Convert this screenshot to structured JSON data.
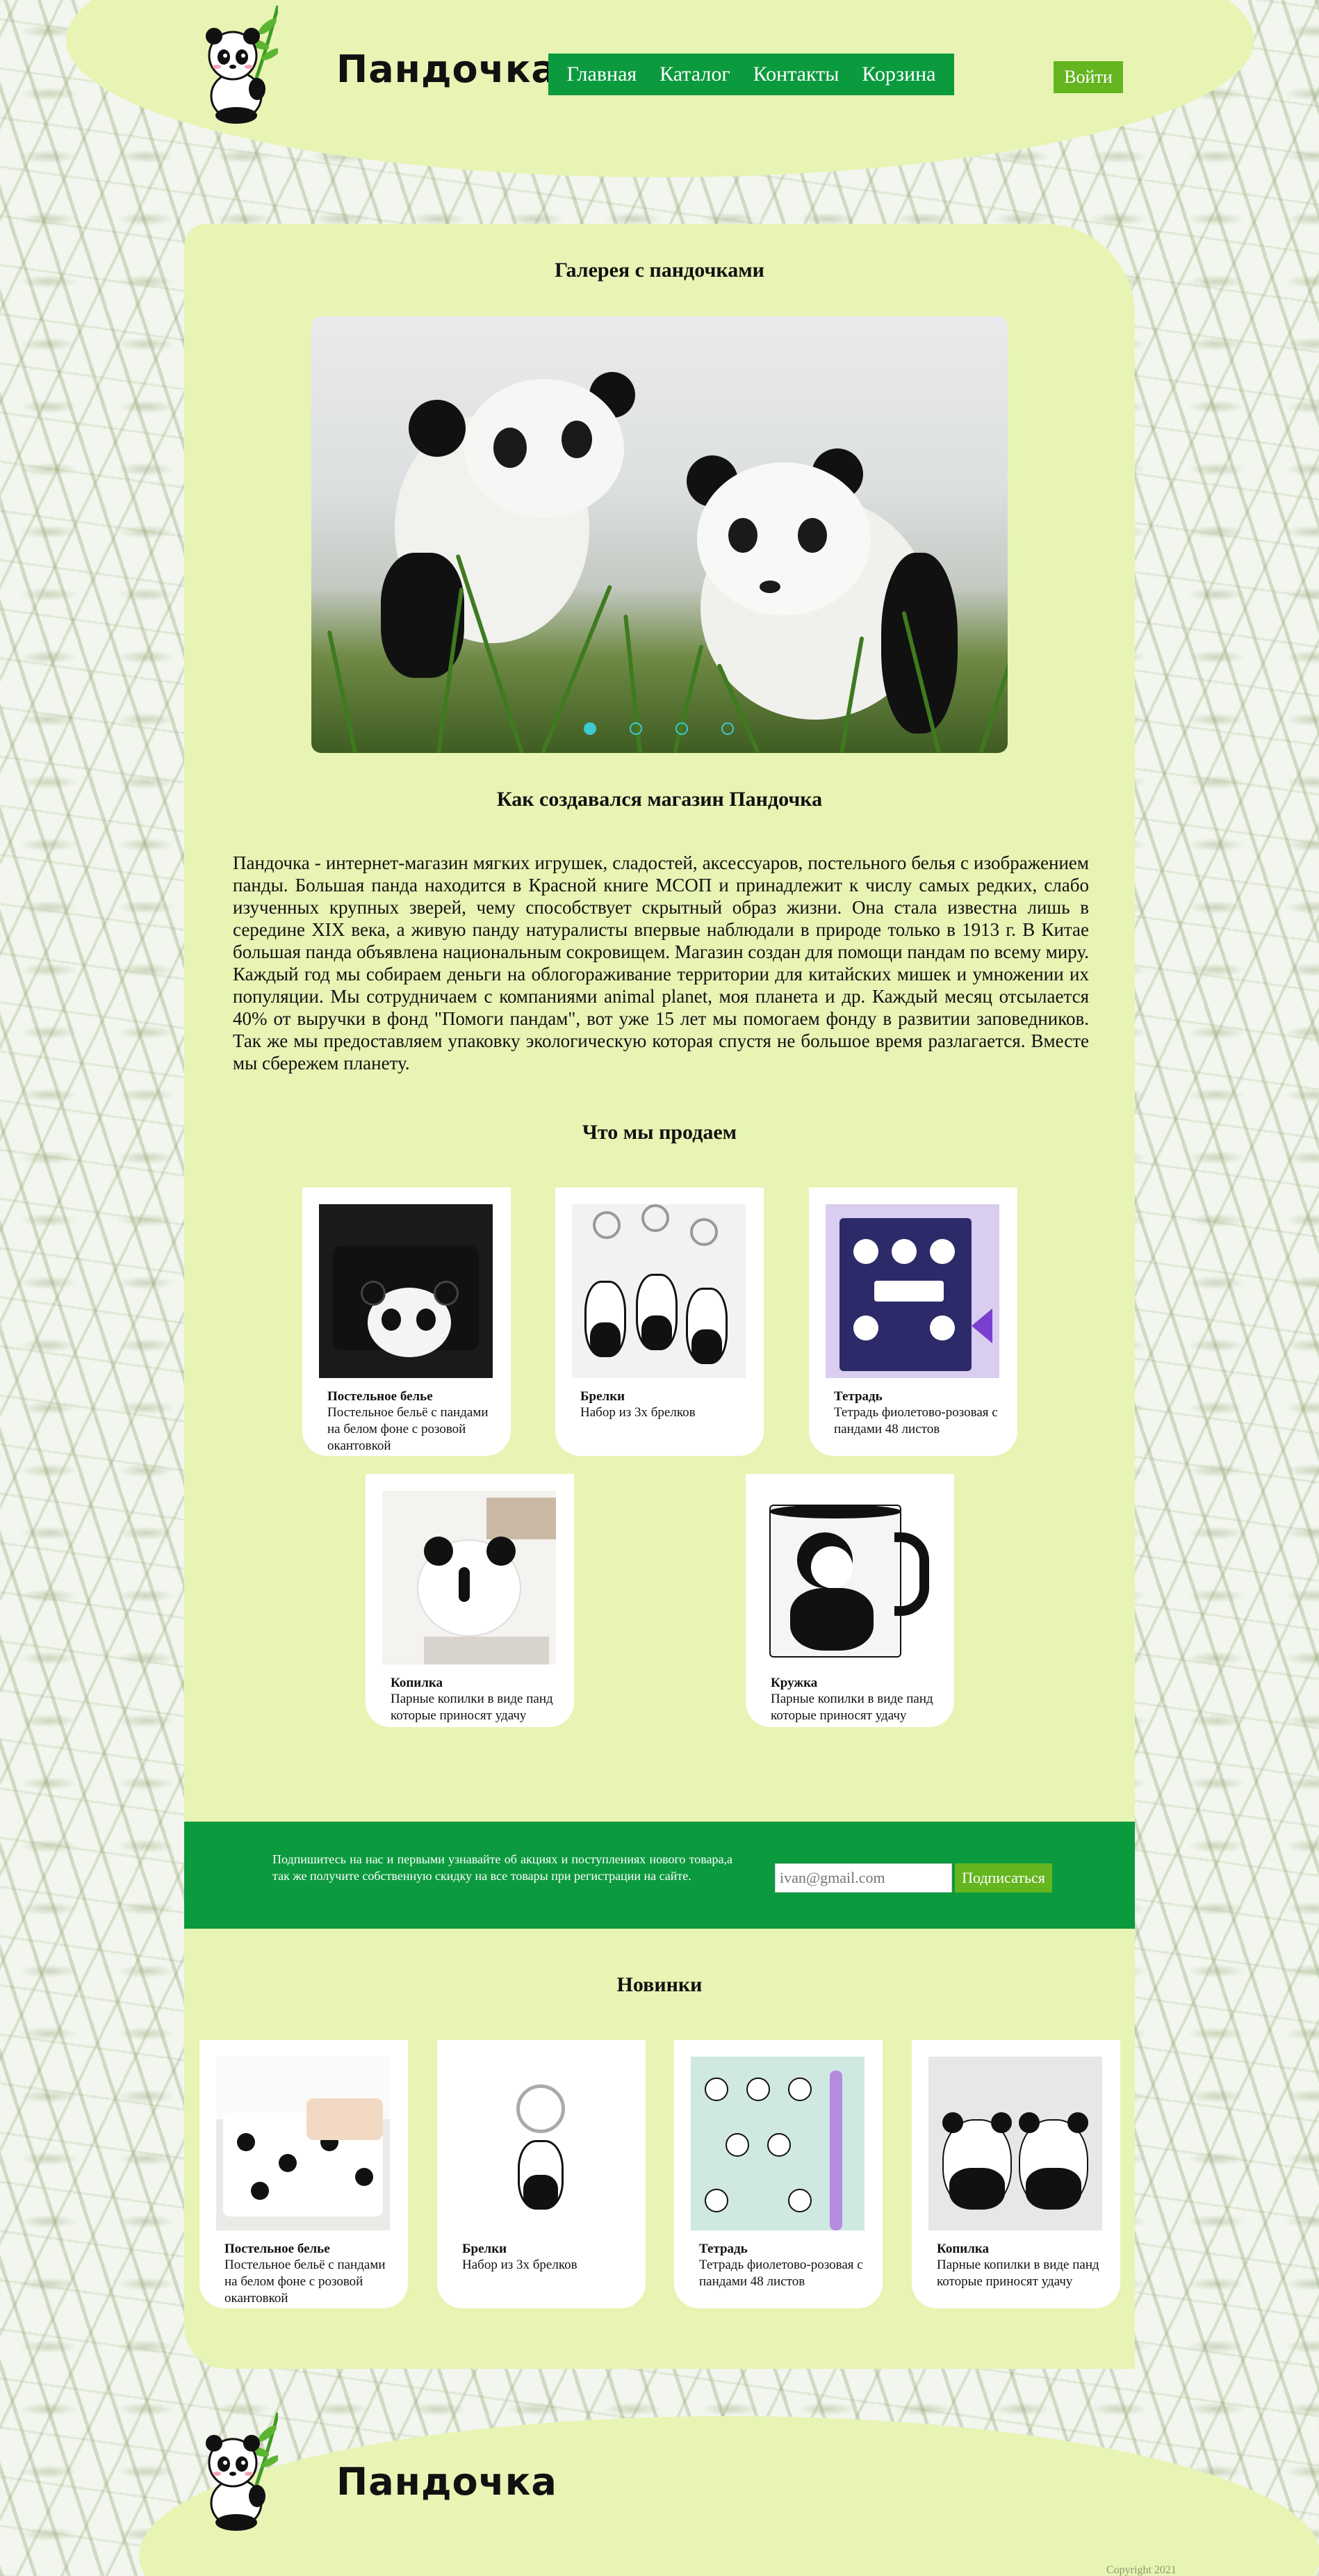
{
  "header": {
    "logo_text": "Пандочка",
    "nav": [
      "Главная",
      "Каталог",
      "Контакты",
      "Корзина"
    ],
    "login_label": "Войти"
  },
  "gallery": {
    "title": "Галерея с пандочками",
    "slides_total": 4,
    "active_slide": 1
  },
  "about": {
    "title": "Как создавался магазин Пандочка",
    "text": "Пандочка - интернет-магазин мягких игрушек, сладостей, аксессуаров, постельного белья с изображением панды. Большая панда находится в Красной книге МСОП и принадлежит к числу самых редких, слабо изученных крупных зверей, чему способствует скрытный образ жизни. Она стала известна лишь в середине XIX века, а живую панду натуралисты впервые наблюдали в природе только в 1913 г. В Китае большая панда объявлена национальным сокровищем. Магазин создан для помощи пандам по всему миру. Каждый год мы собираем деньги на облогораживание территории для китайских мишек и умножении их популяции. Мы сотрудничаем с компаниями animal planet, моя планета и др. Каждый месяц отсылается 40% от выручки в фонд \"Помоги пандам\", вот уже 15 лет мы помогаем фонду в развитии заповедников. Так же мы предоставляем упаковку экологическую которая спустя не большое время разлагается. Вместе мы сбережем планету."
  },
  "products": {
    "title": "Что мы продаем",
    "items": [
      {
        "name": "Постельное белье",
        "desc": "Постельное бельё с пандами на белом фоне с розовой окантовкой"
      },
      {
        "name": "Брелки",
        "desc": "Набор из 3х брелков"
      },
      {
        "name": "Тетрадь",
        "desc": "Тетрадь фиолетово-розовая с пандами 48 листов"
      },
      {
        "name": "Копилка",
        "desc": "Парные копилки в виде панд которые приносят удачу"
      },
      {
        "name": "Кружка",
        "desc": "Парные копилки в виде панд которые приносят удачу"
      }
    ]
  },
  "subscribe": {
    "text": "Подпишитесь на нас и первыми узнавайте об акциях и поступлениях нового товара,а так же получите собственную скидку на все товары при регистрации на сайте.",
    "placeholder": "ivan@gmail.com",
    "button": "Подписаться"
  },
  "new_items": {
    "title": "Новинки",
    "items": [
      {
        "name": "Постельное белье",
        "desc": "Постельное бельё с пандами на белом фоне с розовой окантовкой"
      },
      {
        "name": "Брелки",
        "desc": "Набор из 3х брелков"
      },
      {
        "name": "Тетрадь",
        "desc": "Тетрадь фиолетово-розовая с пандами 48 листов"
      },
      {
        "name": "Копилка",
        "desc": "Парные копилки в виде панд которые приносят удачу"
      }
    ]
  },
  "footer": {
    "logo_text": "Пандочка",
    "copyright": "Copyright 2021"
  },
  "colors": {
    "panel": "#e7f4b4",
    "nav_green": "#0b9a3e",
    "button_green": "#64b520",
    "slider_dot": "#3cc9d0"
  }
}
